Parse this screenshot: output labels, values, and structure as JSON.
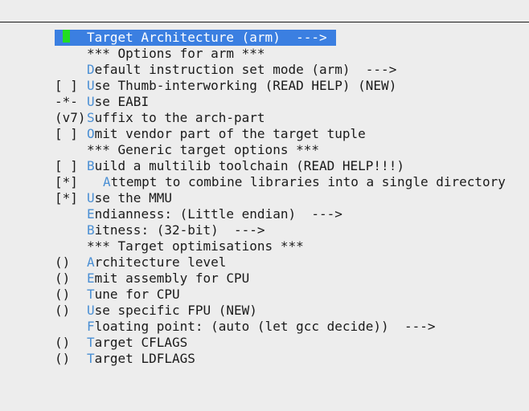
{
  "menu": {
    "items": [
      {
        "prefix": "",
        "hotkey": "",
        "label": "Target Architecture (arm)  --->",
        "selected": true
      },
      {
        "prefix": "",
        "hotkey": "",
        "label": "*** Options for arm ***"
      },
      {
        "prefix": "",
        "hotkey": "D",
        "label": "efault instruction set mode (arm)  --->"
      },
      {
        "prefix": "[ ]",
        "hotkey": "U",
        "label": "se Thumb-interworking (READ HELP) (NEW)"
      },
      {
        "prefix": "-*-",
        "hotkey": "U",
        "label": "se EABI"
      },
      {
        "prefix": "(v7)",
        "hotkey": "S",
        "label": "uffix to the arch-part"
      },
      {
        "prefix": "[ ]",
        "hotkey": "O",
        "label": "mit vendor part of the target tuple"
      },
      {
        "prefix": "",
        "hotkey": "",
        "label": "*** Generic target options ***"
      },
      {
        "prefix": "[ ]",
        "hotkey": "B",
        "label": "uild a multilib toolchain (READ HELP!!!)"
      },
      {
        "prefix": "[*]",
        "hotkey": "A",
        "label": "ttempt to combine libraries into a single directory",
        "indent": true
      },
      {
        "prefix": "[*]",
        "hotkey": "U",
        "label": "se the MMU"
      },
      {
        "prefix": "",
        "hotkey": "E",
        "label": "ndianness: (Little endian)  --->"
      },
      {
        "prefix": "",
        "hotkey": "B",
        "label": "itness: (32-bit)  --->"
      },
      {
        "prefix": "",
        "hotkey": "",
        "label": "*** Target optimisations ***"
      },
      {
        "prefix": "()",
        "hotkey": "A",
        "label": "rchitecture level"
      },
      {
        "prefix": "()",
        "hotkey": "E",
        "label": "mit assembly for CPU"
      },
      {
        "prefix": "()",
        "hotkey": "T",
        "label": "une for CPU"
      },
      {
        "prefix": "()",
        "hotkey": "U",
        "label": "se specific FPU (NEW)"
      },
      {
        "prefix": "",
        "hotkey": "F",
        "label": "loating point: (auto (let gcc decide))  --->"
      },
      {
        "prefix": "()",
        "hotkey": "T",
        "label": "arget CFLAGS"
      },
      {
        "prefix": "()",
        "hotkey": "T",
        "label": "arget LDFLAGS"
      }
    ]
  }
}
